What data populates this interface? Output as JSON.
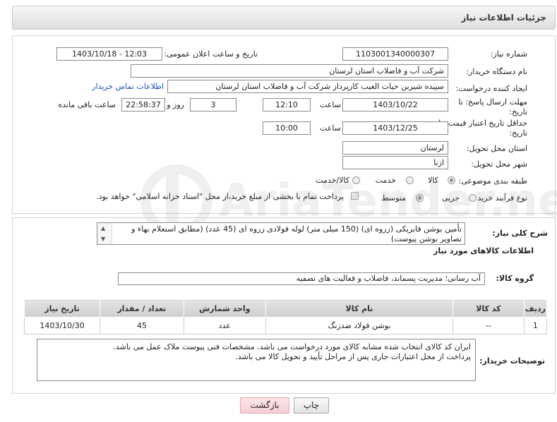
{
  "header": {
    "title": "جزئیات اطلاعات نیاز"
  },
  "form": {
    "need_number_label": "شماره نیاز:",
    "need_number": "1103001340000307",
    "announce_label": "تاریخ و ساعت اعلان عمومی:",
    "announce_value": "1403/10/18 - 12:03",
    "buyer_org_label": "نام دستگاه خریدار:",
    "buyer_org": "شرکت آب و فاضلاب استان لرستان",
    "creator_label": "ایجاد کننده درخواست:",
    "creator": "سپیده شیرین حیات الغیب کارپرداز شرکت آب و فاضلاب استان لرستان",
    "contact_link": "اطلاعات تماس خریدار",
    "reply_deadline_label_1": "مهلت ارسال پاسخ: تا",
    "reply_deadline_label_2": "تاریخ:",
    "reply_date": "1403/10/22",
    "time_label": "ساعت",
    "reply_time": "12:10",
    "days_value": "3",
    "days_and_label": "روز و",
    "remaining_time": "22:58:37",
    "remaining_label": "ساعت باقی مانده",
    "price_validity_label_1": "حداقل تاریخ اعتبار قیمت: تا",
    "price_validity_label_2": "تاریخ:",
    "price_date": "1403/12/25",
    "price_time": "10:00",
    "province_label": "استان محل تحویل:",
    "province": "لرستان",
    "city_label": "شهر محل تحویل:",
    "city": "ازنا",
    "category_label": "طبقه بندی موضوعی:",
    "category_options": [
      "کالا",
      "خدمت",
      "کالا/خدمت"
    ],
    "category_selected": "کالا",
    "process_label": "نوع فرآیند خرید :",
    "process_options": [
      "جزیی",
      "متوسط"
    ],
    "process_selected": "متوسط",
    "payment_note": "پرداخت تمام یا بخشی از مبلغ خرید،از محل \"اسناد خزانه اسلامی\" خواهد بود."
  },
  "details": {
    "general_desc_label": "شرح کلی نیاز:",
    "general_desc": "تأمین بوشن فابریکی (زروه ای) (150 میلی متر) لوله فولادی زروه ای (45 عدد) (مطابق استعلام بهاء و تصاویر بوشن پیوست)",
    "goods_info_title": "اطلاعات کالاهای مورد نیاز",
    "goods_group_label": "گروه کالا:",
    "goods_group": "آب رسانی؛ مدیریت پسماند، فاضلاب و فعالیت های تصفیه",
    "table": {
      "headers": [
        "ردیف",
        "کد کالا",
        "نام کالا",
        "واحد شمارش",
        "تعداد / مقدار",
        "تاریخ نیاز"
      ],
      "rows": [
        [
          "1",
          "--",
          "بوشن فولاد ضدزنگ",
          "عدد",
          "45",
          "1403/10/30"
        ]
      ]
    },
    "buyer_desc_label": "توضیحات خریدار:",
    "buyer_desc_line1": "ایران کد کالای انتخاب شده مشابه کالای مورد درخواست می باشد. مشخصات فنی پیوست ملاک عمل می باشد.",
    "buyer_desc_line2": "پرداخت از محل اعتبارات جاری پس از مراحل تأیید و تحویل کالا می باشد."
  },
  "buttons": {
    "print": "چاپ",
    "back": "بازگشت"
  },
  "watermark_text": "AriaTender.neT"
}
